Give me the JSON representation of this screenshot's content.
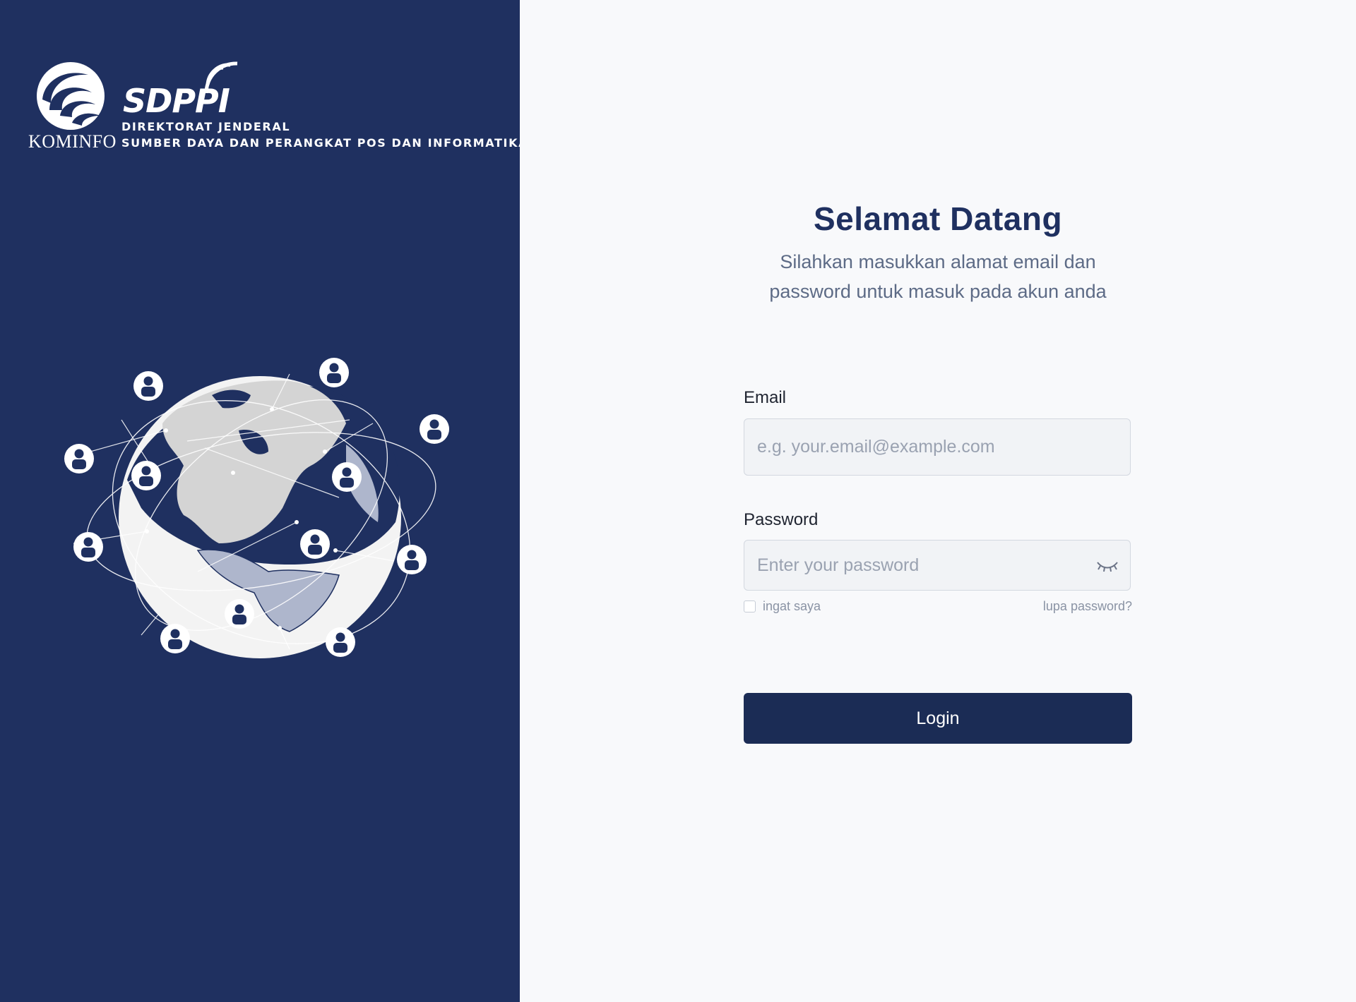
{
  "brand": {
    "kominfo": "KOMINFO",
    "sdppi": "SDPPI",
    "line1": "DIREKTORAT JENDERAL",
    "line2": "SUMBER DAYA DAN PERANGKAT POS DAN INFORMATIKA"
  },
  "login": {
    "title": "Selamat Datang",
    "subtitle_line1": "Silahkan masukkan alamat email dan",
    "subtitle_line2": "password untuk masuk pada akun anda",
    "email_label": "Email",
    "email_placeholder": "e.g. your.email@example.com",
    "password_label": "Password",
    "password_placeholder": "Enter your password",
    "remember_label": "ingat saya",
    "forgot_label": "lupa password?",
    "login_label": "Login"
  },
  "colors": {
    "sidebar_bg": "#1f3060",
    "page_bg": "#f8f9fb",
    "primary": "#1b2c55",
    "title": "#1f3060",
    "muted": "#8a93a4"
  },
  "icons": {
    "emblem": "kominfo-emblem-icon",
    "signal": "sdppi-signal-icon",
    "globe": "globe-network-icon",
    "user": "user-icon",
    "eye": "eye-closed-icon"
  }
}
